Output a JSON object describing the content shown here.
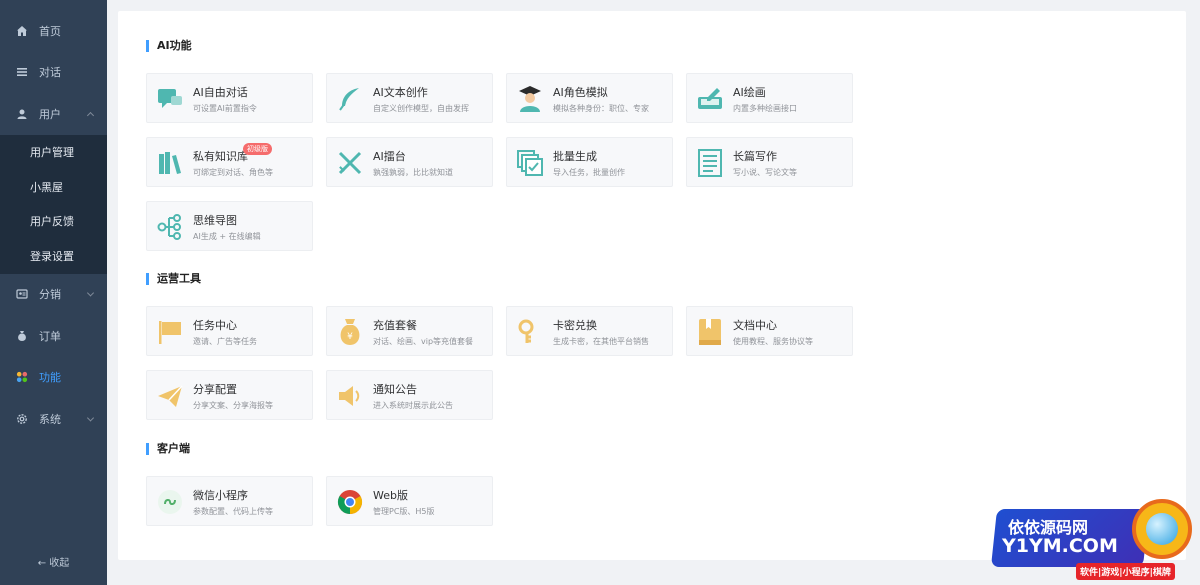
{
  "sidebar": {
    "items": [
      {
        "label": "首页",
        "icon": "home-icon"
      },
      {
        "label": "对话",
        "icon": "list-icon"
      },
      {
        "label": "用户",
        "icon": "user-icon",
        "expanded": true
      },
      {
        "label": "分销",
        "icon": "distribution-icon"
      },
      {
        "label": "订单",
        "icon": "money-bag-icon"
      },
      {
        "label": "功能",
        "icon": "grid-icon",
        "active": true
      },
      {
        "label": "系统",
        "icon": "gear-icon"
      }
    ],
    "user_submenu": [
      "用户管理",
      "小黑屋",
      "用户反馈",
      "登录设置"
    ],
    "collapse_label": "收起",
    "collapse_icon": "←"
  },
  "sections": [
    {
      "title": "AI功能"
    },
    {
      "title": "运营工具"
    },
    {
      "title": "客户端"
    }
  ],
  "cards": {
    "ai": [
      {
        "title": "AI自由对话",
        "desc": "可设置AI前置指令",
        "icon": "chat-bubble-icon"
      },
      {
        "title": "AI文本创作",
        "desc": "自定义创作模型，自由发挥",
        "icon": "feather-icon"
      },
      {
        "title": "AI角色模拟",
        "desc": "模拟各种身份：职位、专家",
        "icon": "graduate-icon"
      },
      {
        "title": "AI绘画",
        "desc": "内置多种绘画接口",
        "icon": "painting-icon"
      },
      {
        "title": "私有知识库",
        "desc": "可绑定到对话、角色等",
        "icon": "books-icon",
        "badge": "初级版"
      },
      {
        "title": "AI擂台",
        "desc": "孰强孰弱，比比就知道",
        "icon": "swords-icon"
      },
      {
        "title": "批量生成",
        "desc": "导入任务，批量创作",
        "icon": "batch-icon"
      },
      {
        "title": "长篇写作",
        "desc": "写小说、写论文等",
        "icon": "document-icon"
      },
      {
        "title": "思维导图",
        "desc": "AI生成 + 在线编辑",
        "icon": "mindmap-icon"
      }
    ],
    "ops": [
      {
        "title": "任务中心",
        "desc": "邀请、广告等任务",
        "icon": "flag-icon"
      },
      {
        "title": "充值套餐",
        "desc": "对话、绘画、vip等充值套餐",
        "icon": "money-bag-icon"
      },
      {
        "title": "卡密兑换",
        "desc": "生成卡密，在其他平台销售",
        "icon": "key-icon"
      },
      {
        "title": "文档中心",
        "desc": "使用教程、服务协议等",
        "icon": "book-icon"
      },
      {
        "title": "分享配置",
        "desc": "分享文案、分享海报等",
        "icon": "paper-plane-icon"
      },
      {
        "title": "通知公告",
        "desc": "进入系统时展示此公告",
        "icon": "speaker-icon"
      }
    ],
    "client": [
      {
        "title": "微信小程序",
        "desc": "参数配置、代码上传等",
        "icon": "mini-program-icon"
      },
      {
        "title": "Web版",
        "desc": "管理PC版、H5版",
        "icon": "chrome-icon"
      }
    ]
  },
  "colors": {
    "sidebar_bg": "#304156",
    "submenu_bg": "#1f2d3d",
    "accent": "#409eff",
    "teal": "#4fb7b0",
    "gold": "#f0c46a",
    "badge": "#f56c6c"
  },
  "watermark": {
    "line1": "依依源码网",
    "line2": "Y1YM.COM",
    "line3": "软件|游戏|小程序|棋牌"
  }
}
